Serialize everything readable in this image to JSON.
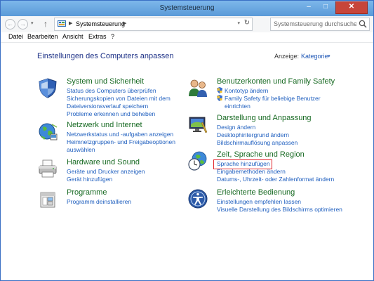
{
  "window": {
    "title": "Systemsteuerung",
    "minimize": "–",
    "maximize": "□",
    "close": "✕"
  },
  "address_bar": {
    "back_glyph": "←",
    "forward_glyph": "→",
    "history_glyph": "▾",
    "up_glyph": "↑",
    "breadcrumb_arrow": "▶",
    "path": "Systemsteuerung",
    "dropdown_glyph": "▾",
    "refresh_glyph": "↻",
    "search_placeholder": "Systemsteuerung durchsuchen"
  },
  "menu": {
    "items": [
      "Datei",
      "Bearbeiten",
      "Ansicht",
      "Extras",
      "?"
    ]
  },
  "page": {
    "title": "Einstellungen des Computers anpassen",
    "view_label": "Anzeige:",
    "view_value": "Kategorie",
    "view_dropdown_glyph": "▾"
  },
  "categories": {
    "system": {
      "title": "System und Sicherheit",
      "links": [
        "Status des Computers überprüfen",
        "Sicherungskopien von Dateien mit dem",
        "Dateiversionsverlauf speichern",
        "Probleme erkennen und beheben"
      ]
    },
    "network": {
      "title": "Netzwerk und Internet",
      "links": [
        "Netzwerkstatus und -aufgaben anzeigen",
        "Heimnetzgruppen- und Freigabeoptionen",
        "auswählen"
      ]
    },
    "hardware": {
      "title": "Hardware und Sound",
      "links": [
        "Geräte und Drucker anzeigen",
        "Gerät hinzufügen"
      ]
    },
    "programs": {
      "title": "Programme",
      "links": [
        "Programm deinstallieren"
      ]
    },
    "users": {
      "title": "Benutzerkonten und Family Safety",
      "links": [
        "Kontotyp ändern",
        "Family Safety für beliebige Benutzer",
        "einrichten"
      ]
    },
    "appearance": {
      "title": "Darstellung und Anpassung",
      "links": [
        "Design ändern",
        "Desktophintergrund ändern",
        "Bildschirmauflösung anpassen"
      ]
    },
    "clock": {
      "title": "Zeit, Sprache und Region",
      "links": [
        "Sprache hinzufügen",
        "Eingabemethoden ändern",
        "Datums-, Uhrzeit- oder Zahlenformat ändern"
      ]
    },
    "ease": {
      "title": "Erleichterte Bedienung",
      "links": [
        "Einstellungen empfehlen lassen",
        "Visuelle Darstellung des Bildschirms optimieren"
      ]
    }
  },
  "colors": {
    "title_bar": "#6fa8e0",
    "category_title": "#196b24",
    "link": "#1f5fbf",
    "page_title": "#1e3287",
    "highlight": "#e0262c",
    "close_button": "#c7453a"
  }
}
